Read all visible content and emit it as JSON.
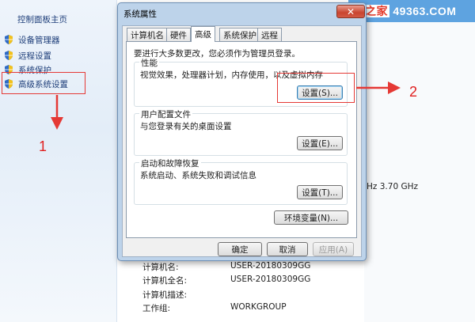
{
  "sidebar": {
    "title": "控制面板主页",
    "items": [
      {
        "label": "设备管理器"
      },
      {
        "label": "远程设置"
      },
      {
        "label": "系统保护"
      },
      {
        "label": "高级系统设置"
      }
    ]
  },
  "annotations": {
    "step1": "1",
    "step2": "2"
  },
  "watermark": {
    "brand": "系统之家",
    "site": "49363.COM"
  },
  "background": {
    "cpu_speed_partial": "Hz  3.70 GHz",
    "computer_name_label": "计算机名:",
    "computer_name_value": "USER-20180309GG",
    "full_name_label": "计算机全名:",
    "full_name_value": "USER-20180309GG",
    "description_label": "计算机描述:",
    "workgroup_label": "工作组:",
    "workgroup_value": "WORKGROUP"
  },
  "dialog": {
    "title": "系统属性",
    "close_glyph": "✕",
    "tabs": [
      {
        "label": "计算机名"
      },
      {
        "label": "硬件"
      },
      {
        "label": "高级"
      },
      {
        "label": "系统保护"
      },
      {
        "label": "远程"
      }
    ],
    "notice": "要进行大多数更改，您必须作为管理员登录。",
    "performance": {
      "title": "性能",
      "desc": "视觉效果，处理器计划，内存使用，以及虚拟内存",
      "button": "设置(S)..."
    },
    "user_profiles": {
      "title": "用户配置文件",
      "desc": "与您登录有关的桌面设置",
      "button": "设置(E)..."
    },
    "startup": {
      "title": "启动和故障恢复",
      "desc": "系统启动、系统失败和调试信息",
      "button": "设置(T)..."
    },
    "env_button": "环境变量(N)...",
    "ok": "确定",
    "cancel": "取消",
    "apply": "应用(A)"
  },
  "colors": {
    "annotation_red": "#e53935",
    "link_blue": "#1f3f7a",
    "window_frame": "#bdd3ea"
  }
}
